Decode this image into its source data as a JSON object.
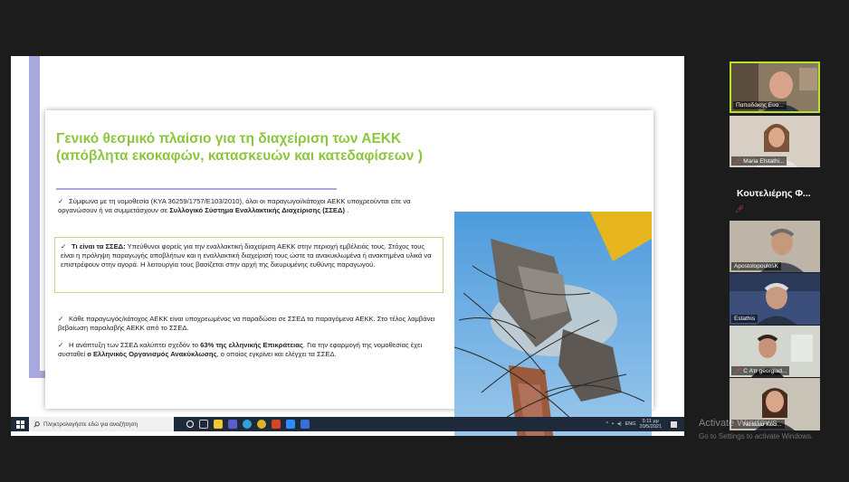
{
  "slide": {
    "title_line1": "Γενικό θεσμικό πλαίσιο για τη διαχείριση των ΑΕΚΚ",
    "title_line2": "(απόβλητα εκοκαφών, κατασκευών και κατεδαφίσεων )",
    "bullet1": {
      "text": "Σύμφωνα με τη νομοθεσία (ΚΥΑ 36259/1757/Ε103/2010), όλοι οι παραγωγοί/κάτοχοι ΑΕΚΚ υποχρεούνται είτε να οργανώσουν ή να συμμετάσχουν σε ",
      "bold": "Συλλογικό Σύστημα Εναλλακτικής Διαχείρισης (ΣΣΕΔ)",
      "tail": " ."
    },
    "bullet2": {
      "bold": "Τι είναι τα ΣΣΕΔ:",
      "text": " Υπεύθυνοι φορείς για την εναλλακτική διαχείριση ΑΕΚΚ στην περιοχή εμβέλειάς τους. Στόχος τους είναι η πρόληψη παραγωγής αποβλήτων και η εναλλακτική διαχείρισή τους ώστε τα ανακυκλωμένα ή ανακτημένα υλικά να επιστρέφουν στην αγορά. Η λειτουργία τους βασίζεται στην αρχή της διευρυμένης ευθύνης παραγωγού."
    },
    "bullet3": {
      "text": "Κάθε παραγωγός/κάτοχος ΑΕΚΚ είναι υποχρεωμένος να παραδώσει σε ΣΣΕΔ τα παραγόμενα ΑΕΚΚ. Στο τέλος λαμβάνει βεβαίωση παραλαβής ΑΕΚΚ από το ΣΣΕΔ."
    },
    "bullet4": {
      "text": "Η ανάπτυξη των ΣΣΕΔ  καλύπτει σχεδόν το ",
      "bold1": "63% της ελληνικής Επικράτειας",
      "mid": ". Για την εφαρμογή της νομοθεσίας έχει συσταθεί ",
      "bold2": "ο Ελληνικός Οργανισμός Ανακύκλωσης",
      "tail": ", ο οποίος εγκρίνει και ελέγχει τα ΣΣΕΔ."
    },
    "check_glyph": "✓"
  },
  "taskbar": {
    "search_placeholder": "Πληκτρολογήστε εδώ για αναζήτηση",
    "lang": "ENG",
    "time": "5:11 μμ",
    "date": "20/5/2021"
  },
  "participants": [
    {
      "name": "Παπαδάκης Ευα..."
    },
    {
      "name": "Maria Efstathi..."
    },
    {
      "name": "Κουτελιέρης Φ..."
    },
    {
      "name": "ApostolopoulosK"
    },
    {
      "name": "Estathis"
    },
    {
      "name": "C Ατr georgiad..."
    },
    {
      "name": "Νατάλια Κοσ..."
    }
  ],
  "watermark": {
    "title": "Activate Windows",
    "subtitle": "Go to Settings to activate Windows."
  },
  "colors": {
    "title_green": "#8cc63e",
    "accent_lavender": "#a7a9de",
    "active_speaker_border": "#b6e32a"
  }
}
